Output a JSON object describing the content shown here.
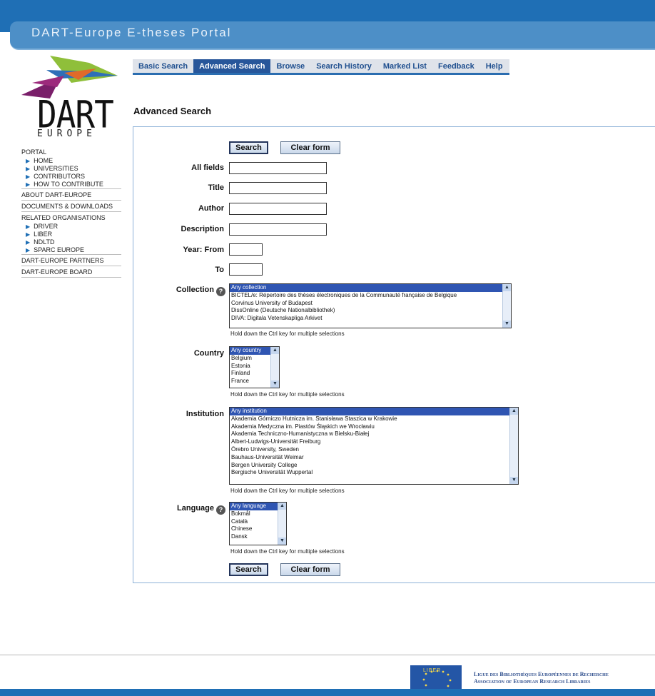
{
  "portal_title": "DART-Europe E-theses Portal",
  "logo": {
    "name": "DART",
    "sub": "EUROPE"
  },
  "tabs": [
    "Basic Search",
    "Advanced Search",
    "Browse",
    "Search History",
    "Marked List",
    "Feedback",
    "Help"
  ],
  "active_tab": "Advanced Search",
  "page_title": "Advanced Search",
  "sidebar": {
    "portal": "PORTAL",
    "portal_items": [
      "HOME",
      "UNIVERSITIES",
      "CONTRIBUTORS",
      "HOW TO CONTRIBUTE"
    ],
    "about": "ABOUT DART-EUROPE",
    "documents": "DOCUMENTS & DOWNLOADS",
    "related": "RELATED ORGANISATIONS",
    "related_items": [
      "DRIVER",
      "LIBER",
      "NDLTD",
      "SPARC EUROPE"
    ],
    "partners": "DART-EUROPE PARTNERS",
    "board": "DART-EUROPE BOARD"
  },
  "buttons": {
    "search": "Search",
    "clear": "Clear form"
  },
  "fields": {
    "all_fields": "All fields",
    "title": "Title",
    "author": "Author",
    "description": "Description",
    "year_from": "Year: From",
    "year_to": "To"
  },
  "collection": {
    "label": "Collection",
    "options": [
      "Any collection",
      "BICTEL/e: Répertoire des thèses électroniques de la Communauté française de Belgique",
      "Corvinus University of Budapest",
      "DissOnline (Deutsche Nationalbibliothek)",
      "DIVA: Digitala Vetenskapliga Arkivet"
    ]
  },
  "country": {
    "label": "Country",
    "options": [
      "Any country",
      "Belgium",
      "Estonia",
      "Finland",
      "France"
    ]
  },
  "institution": {
    "label": "Institution",
    "options": [
      "Any institution",
      "Akademia Górniczo Hutnicza im. Stanisława Staszica w Krakowie",
      "Akademia Medyczna im. Piastów Śląskich we Wrocławiu",
      "Akademia Techniczno-Humanistyczna w Bielsku-Białej",
      "Albert-Ludwigs-Universität Freiburg",
      "Örebro University, Sweden",
      "Bauhaus-Universität Weimar",
      "Bergen University College",
      "Bergische Universität Wuppertal"
    ]
  },
  "language": {
    "label": "Language",
    "options": [
      "Any language",
      "Bokmål",
      "Català",
      "Chinese",
      "Dansk"
    ]
  },
  "hint": "Hold down the Ctrl key for multiple selections",
  "help_glyph": "?",
  "footer": {
    "line1": "Ligue des Bibliothèques Européennes de Recherche",
    "line2": "Association of European Research Libraries",
    "flag_text": "LIBER"
  },
  "colors": {
    "brand_blue": "#1f6fb5",
    "tab_active": "#27569a",
    "selected_option": "#2f55b2"
  }
}
